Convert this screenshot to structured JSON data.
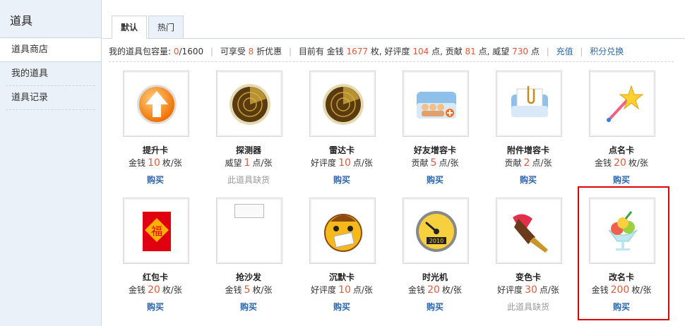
{
  "sidebar": {
    "title": "道具",
    "items": [
      {
        "label": "道具商店"
      },
      {
        "label": "我的道具"
      },
      {
        "label": "道具记录"
      }
    ]
  },
  "tabs": [
    {
      "label": "默认"
    },
    {
      "label": "热门"
    }
  ],
  "info": {
    "capacity_label": "我的道具包容量:",
    "capacity_used": "0",
    "capacity_total": "/1600",
    "discount_prefix": "可享受",
    "discount_value": "8",
    "discount_suffix": "折优惠",
    "have_prefix": "目前有 金钱",
    "money": "1677",
    "money_unit": "枚, 好评度",
    "rep": "104",
    "rep_unit": "点, 贡献",
    "contrib": "81",
    "contrib_unit": "点, 威望",
    "prestige": "730",
    "prestige_unit": "点",
    "recharge_link": "充值",
    "exchange_link": "积分兑换"
  },
  "items": [
    {
      "name": "提升卡",
      "currency": "金钱",
      "amount": "10",
      "unit": "枚/张",
      "action": "购买",
      "icon": "arrow-up-icon"
    },
    {
      "name": "探测器",
      "currency": "威望",
      "amount": "1",
      "unit": "点/张",
      "action": "此道具缺货",
      "icon": "radar-icon"
    },
    {
      "name": "雷达卡",
      "currency": "好评度",
      "amount": "10",
      "unit": "点/张",
      "action": "购买",
      "icon": "radar-icon"
    },
    {
      "name": "好友增容卡",
      "currency": "贡献",
      "amount": "5",
      "unit": "点/张",
      "action": "购买",
      "icon": "friends-card-icon"
    },
    {
      "name": "附件增容卡",
      "currency": "贡献",
      "amount": "2",
      "unit": "点/张",
      "action": "购买",
      "icon": "paperclip-icon"
    },
    {
      "name": "点名卡",
      "currency": "金钱",
      "amount": "20",
      "unit": "枚/张",
      "action": "购买",
      "icon": "star-wand-icon"
    },
    {
      "name": "红包卡",
      "currency": "金钱",
      "amount": "20",
      "unit": "枚/张",
      "action": "购买",
      "icon": "red-envelope-icon",
      "glyph": "福"
    },
    {
      "name": "抢沙发",
      "currency": "金钱",
      "amount": "5",
      "unit": "枚/张",
      "action": "购买",
      "icon": "broken-image-icon"
    },
    {
      "name": "沉默卡",
      "currency": "好评度",
      "amount": "10",
      "unit": "点/张",
      "action": "购买",
      "icon": "silenced-face-icon"
    },
    {
      "name": "时光机",
      "currency": "金钱",
      "amount": "20",
      "unit": "枚/张",
      "action": "购买",
      "icon": "gauge-icon",
      "gauge_label": "2010"
    },
    {
      "name": "变色卡",
      "currency": "好评度",
      "amount": "30",
      "unit": "点/张",
      "action": "此道具缺货",
      "icon": "paint-brush-icon"
    },
    {
      "name": "改名卡",
      "currency": "金钱",
      "amount": "200",
      "unit": "枚/张",
      "action": "购买",
      "icon": "ice-cream-icon"
    }
  ],
  "colors": {
    "accent": "#e05a3a",
    "link": "#2d67a8",
    "highlight": "#e00000"
  }
}
